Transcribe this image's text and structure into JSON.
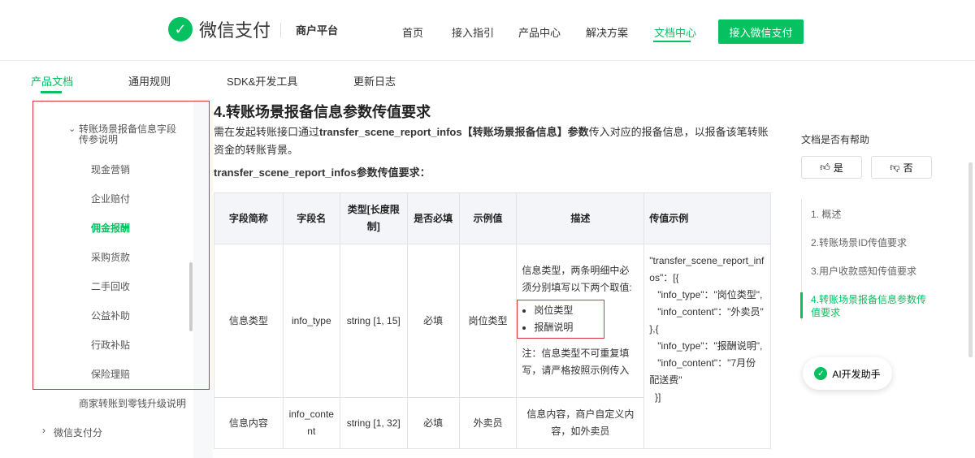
{
  "header": {
    "brand": "微信支付",
    "merchant": "商户平台",
    "nav": [
      "首页",
      "接入指引",
      "产品中心",
      "解决方案",
      "文档中心"
    ],
    "cta": "接入微信支付"
  },
  "tabs": [
    "产品文档",
    "通用规则",
    "SDK&开发工具",
    "更新日志"
  ],
  "sidebar": {
    "group": "转账场景报备信息字段传参说明",
    "items": [
      "现金营销",
      "企业赔付",
      "佣金报酬",
      "采购货款",
      "二手回收",
      "公益补助",
      "行政补贴",
      "保险理赔"
    ],
    "after": "商家转账到零钱升级说明",
    "next": "微信支付分"
  },
  "content": {
    "title": "4.转账场景报备信息参数传值要求",
    "intro_pre": "需在发起转账接口通过",
    "intro_bold": "transfer_scene_report_infos【转账场景报备信息】参数",
    "intro_post": "传入对应的报备信息，以报备该笔转账资金的转账背景。",
    "subtitle": "transfer_scene_report_infos参数传值要求：",
    "table": {
      "headers": [
        "字段简称",
        "字段名",
        "类型[长度限制]",
        "是否必填",
        "示例值",
        "描述",
        "传值示例"
      ],
      "rows": [
        {
          "name": "信息类型",
          "field": "info_type",
          "type": "string [1, 15]",
          "required": "必填",
          "example": "岗位类型",
          "desc_pre": "信息类型，两条明细中必须分别填写以下两个取值:",
          "bullets": [
            "岗位类型",
            "报酬说明"
          ],
          "desc_post": "注：信息类型不可重复填写，请严格按照示例传入",
          "sample": "\"transfer_scene_report_infos\"：[{\n   \"info_type\"：\"岗位类型\",\n   \"info_content\"：\"外卖员\"\n},{\n   \"info_type\"：\"报酬说明\",\n   \"info_content\"：\"7月份配送费\"\n  }]"
        },
        {
          "name": "信息内容",
          "field": "info_content",
          "type": "string [1, 32]",
          "required": "必填",
          "example": "外卖员",
          "desc": "信息内容，商户自定义内容，如外卖员"
        }
      ]
    }
  },
  "right": {
    "help": "文档是否有帮助",
    "yes": "是",
    "no": "否",
    "toc": [
      "1. 概述",
      "2.转账场景ID传值要求",
      "3.用户收款感知传值要求",
      "4.转账场景报备信息参数传值要求"
    ],
    "ai": "AI开发助手"
  }
}
